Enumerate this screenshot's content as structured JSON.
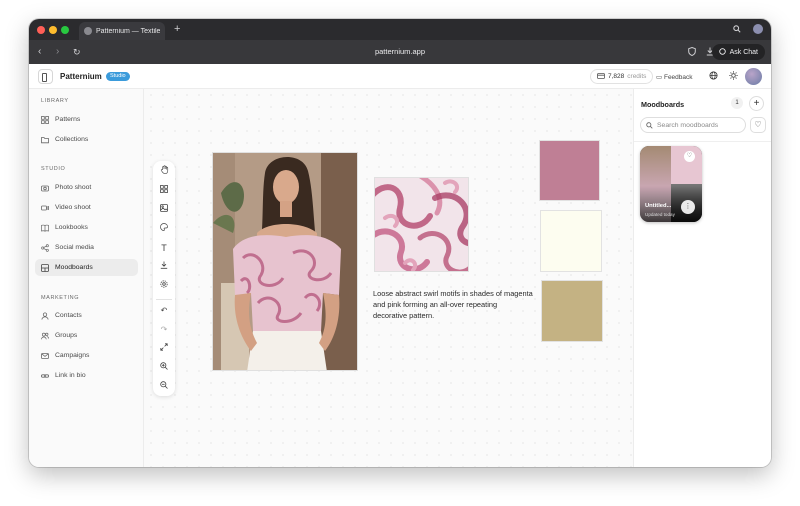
{
  "browser": {
    "tab_title": "Patternium — Textile Studio",
    "url": "patternium.app",
    "ask_chat_label": "Ask Chat",
    "new_tab_glyph": "+",
    "icons": [
      "back-arrow-icon",
      "forward-arrow-icon",
      "reload-icon",
      "shield-icon",
      "download-icon",
      "search-icon"
    ]
  },
  "header": {
    "brand": "Patternium",
    "badge": "Studio",
    "credits_value": "7,828",
    "credits_label": "credits",
    "feedback_label": "Feedback",
    "accent_badge_color": "#3b9bdb"
  },
  "sidebar": {
    "sections": [
      {
        "title": "LIBRARY",
        "items": [
          {
            "label": "Patterns",
            "icon": "grid-icon"
          },
          {
            "label": "Collections",
            "icon": "folder-icon"
          }
        ]
      },
      {
        "title": "STUDIO",
        "items": [
          {
            "label": "Photo shoot",
            "icon": "camera-icon"
          },
          {
            "label": "Video shoot",
            "icon": "video-icon"
          },
          {
            "label": "Lookbooks",
            "icon": "book-icon"
          },
          {
            "label": "Social media",
            "icon": "share-icon"
          },
          {
            "label": "Moodboards",
            "icon": "moodboard-icon",
            "active": true
          }
        ]
      },
      {
        "title": "MARKETING",
        "items": [
          {
            "label": "Contacts",
            "icon": "user-icon"
          },
          {
            "label": "Groups",
            "icon": "users-icon"
          },
          {
            "label": "Campaigns",
            "icon": "mail-icon"
          },
          {
            "label": "Link in bio",
            "icon": "link-icon"
          }
        ]
      }
    ]
  },
  "canvas": {
    "tools": [
      "hand-icon",
      "grid-icon",
      "image-icon",
      "palette-icon",
      "text-icon",
      "download-icon",
      "settings-icon",
      "undo-icon",
      "redo-icon",
      "fit-screen-icon",
      "zoom-in-icon",
      "zoom-out-icon"
    ],
    "description": "Loose abstract swirl motifs in shades of magenta and pink forming an all-over repeating decorative pattern.",
    "swatches": [
      "#bf7f95",
      "#fdfdf0",
      "#c4b283"
    ]
  },
  "right_panel": {
    "title": "Moodboards",
    "count": "1",
    "search_placeholder": "Search moodboards",
    "card": {
      "name": "Untitled...",
      "updated": "Updated today"
    }
  }
}
